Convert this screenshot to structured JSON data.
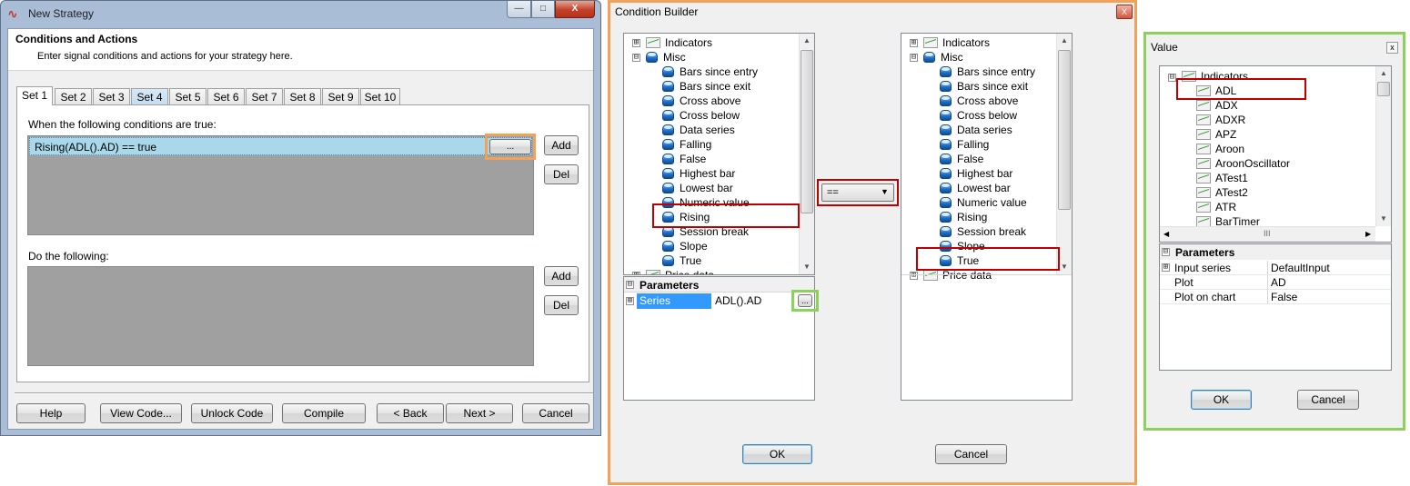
{
  "new_strategy": {
    "title": "New Strategy",
    "header_title": "Conditions and Actions",
    "header_subtitle": "Enter signal conditions and actions for your strategy here.",
    "tabs": [
      "Set 1",
      "Set 2",
      "Set 3",
      "Set 4",
      "Set 5",
      "Set 6",
      "Set 7",
      "Set 8",
      "Set 9",
      "Set 10"
    ],
    "conditions_label": "When the following conditions are true:",
    "condition_row": "Rising(ADL().AD) == true",
    "ellipsis_label": "...",
    "add_label": "Add",
    "del_label": "Del",
    "actions_label": "Do the following:",
    "footer_buttons": {
      "help": "Help",
      "view_code": "View Code...",
      "unlock_code": "Unlock Code",
      "compile": "Compile",
      "back": "< Back",
      "next": "Next >",
      "cancel": "Cancel"
    },
    "caption_buttons": {
      "minimize": "—",
      "maximize": "□",
      "close": "X"
    }
  },
  "condition_builder": {
    "title": "Condition Builder",
    "tree": {
      "indicators": "Indicators",
      "misc": "Misc",
      "misc_items": [
        "Bars since entry",
        "Bars since exit",
        "Cross above",
        "Cross below",
        "Data series",
        "Falling",
        "False",
        "Highest bar",
        "Lowest bar",
        "Numeric value",
        "Rising",
        "Session break",
        "Slope",
        "True"
      ],
      "price_data": "Price data"
    },
    "parameters_label": "Parameters",
    "param_name": "Series",
    "param_value": "ADL().AD",
    "param_ellipsis": "...",
    "operator": "==",
    "ok_label": "OK",
    "cancel_label": "Cancel",
    "close_label": "X"
  },
  "value_dialog": {
    "title": "Value",
    "close_label": "x",
    "tree_root": "Indicators",
    "tree_items": [
      "ADL",
      "ADX",
      "ADXR",
      "APZ",
      "Aroon",
      "AroonOscillator",
      "ATest1",
      "ATest2",
      "ATR",
      "BarTimer"
    ],
    "hscroll_grip": "III",
    "parameters_label": "Parameters",
    "properties": [
      {
        "name": "Input series",
        "value": "DefaultInput"
      },
      {
        "name": "Plot",
        "value": "AD"
      },
      {
        "name": "Plot on chart",
        "value": "False"
      }
    ],
    "ok_label": "OK",
    "cancel_label": "Cancel"
  },
  "icons": {
    "minus_expander": "⊟",
    "plus_expander": "⊞"
  },
  "colors": {
    "selection_blue": "#3399ff",
    "condition_row_bg": "#a8d8ea",
    "highlight_red": "#c00000",
    "frame_orange": "#f1a25a",
    "frame_green": "#8bd15b"
  }
}
